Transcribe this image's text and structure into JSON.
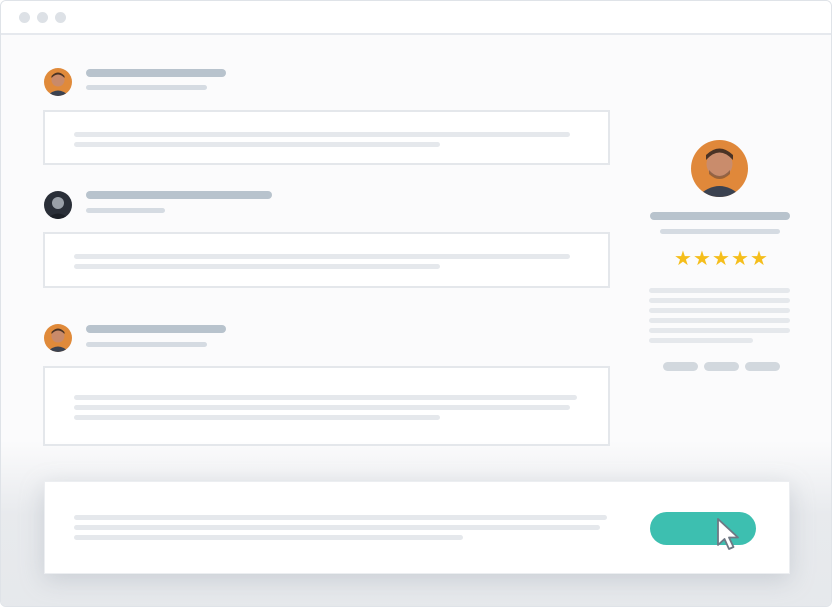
{
  "profile": {
    "rating": 5,
    "rating_max": 5,
    "star_glyph": "★",
    "star_color": "#f5be1b"
  },
  "colors": {
    "accent": "#3dbfb0",
    "placeholder_dark": "#b8c3cd",
    "placeholder_light": "#e5e8ec"
  },
  "icons": [
    "window-dot-icon",
    "avatar-icon",
    "star-icon",
    "cursor-icon"
  ]
}
